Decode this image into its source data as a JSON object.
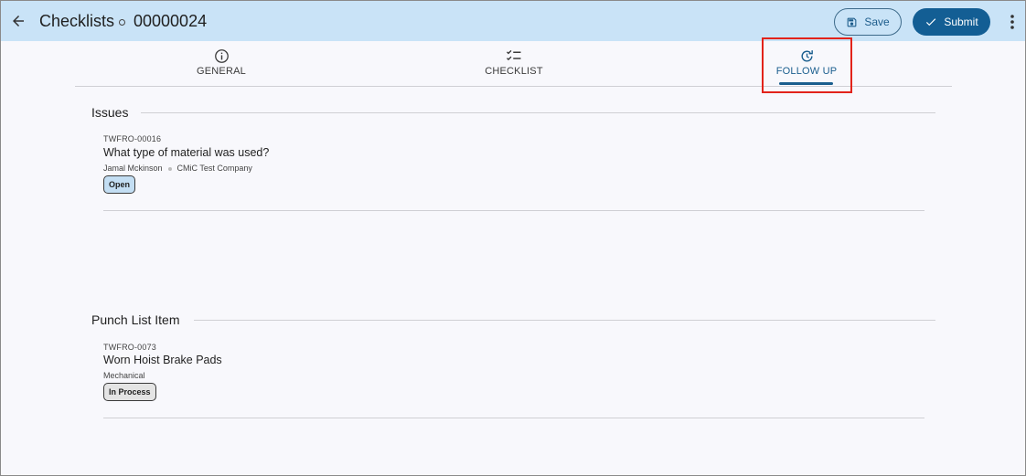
{
  "header": {
    "title": "Checklists",
    "record_id": "00000024",
    "save_label": "Save",
    "submit_label": "Submit"
  },
  "tabs": [
    {
      "label": "GENERAL",
      "icon": "info-icon"
    },
    {
      "label": "CHECKLIST",
      "icon": "checklist-icon"
    },
    {
      "label": "FOLLOW UP",
      "icon": "history-icon",
      "active": true
    }
  ],
  "sections": {
    "issues": {
      "title": "Issues",
      "items": [
        {
          "code": "TWFRO-00016",
          "title": "What type of material was used?",
          "assignee": "Jamal Mckinson",
          "company": "CMiC Test Company",
          "status": "Open"
        }
      ]
    },
    "punch_list": {
      "title": "Punch List Item",
      "items": [
        {
          "code": "TWFRO-0073",
          "title": "Worn Hoist Brake Pads",
          "category": "Mechanical",
          "status": "In Process"
        }
      ]
    }
  },
  "colors": {
    "appbar": "#c9e3f7",
    "primary": "#135e94",
    "highlight": "#e2231a",
    "badge_open": "#c3def3",
    "badge_in_process": "#e4e4e4"
  }
}
